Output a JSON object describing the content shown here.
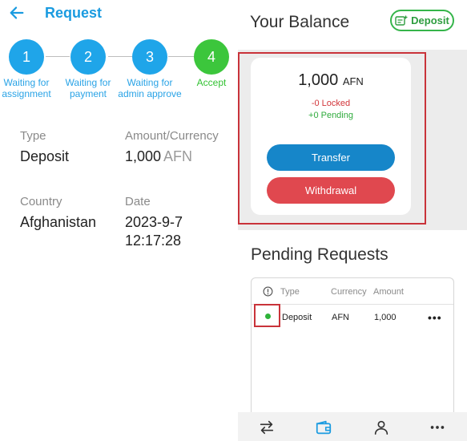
{
  "request_screen": {
    "title": "Request",
    "steps": [
      {
        "number": "1",
        "label": "Waiting for assignment",
        "state": "active"
      },
      {
        "number": "2",
        "label": "Waiting for payment",
        "state": "active"
      },
      {
        "number": "3",
        "label": "Waiting for admin approve",
        "state": "active"
      },
      {
        "number": "4",
        "label": "Accept",
        "state": "done"
      }
    ],
    "fields": {
      "type_label": "Type",
      "type_value": "Deposit",
      "amount_label": "Amount/Currency",
      "amount_value": "1,000",
      "amount_currency": "AFN",
      "country_label": "Country",
      "country_value": "Afghanistan",
      "date_label": "Date",
      "date_value": "2023-9-7",
      "time_value": "12:17:28"
    }
  },
  "balance_screen": {
    "title": "Your Balance",
    "deposit_button": "Deposit",
    "balance_amount": "1,000",
    "balance_currency": "AFN",
    "locked_text": "-0 Locked",
    "pending_text": "+0 Pending",
    "transfer_button": "Transfer",
    "withdrawal_button": "Withdrawal",
    "pending_title": "Pending Requests",
    "table": {
      "headers": {
        "type": "Type",
        "currency": "Currency",
        "amount": "Amount"
      },
      "rows": [
        {
          "status": "green",
          "type": "Deposit",
          "currency": "AFN",
          "amount": "1,000",
          "more": "•••"
        }
      ]
    }
  },
  "colors": {
    "primary_blue": "#1a9be0",
    "accent_green": "#35b54a",
    "danger_red": "#e0484f",
    "highlight_box": "#c9333a"
  },
  "icons": [
    "back-arrow-icon",
    "deposit-icon",
    "info-icon",
    "transfer-arrows-icon",
    "wallet-icon",
    "person-icon",
    "more-icon"
  ]
}
